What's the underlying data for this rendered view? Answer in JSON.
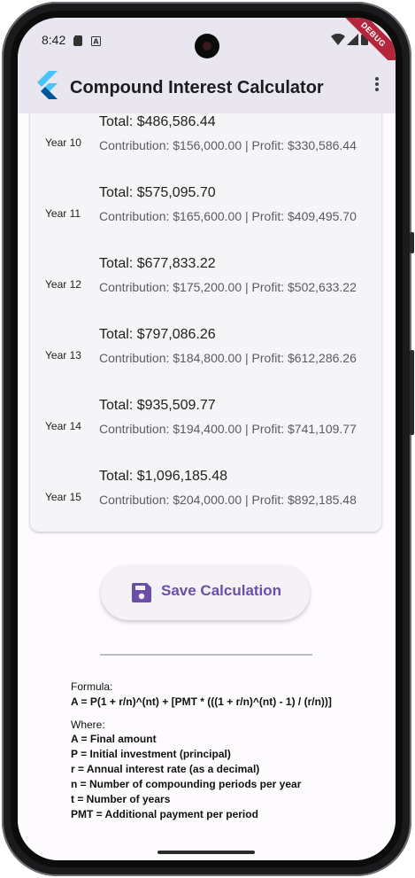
{
  "status_bar": {
    "time": "8:42",
    "debug_banner": "DEBUG"
  },
  "app_bar": {
    "title": "Compound Interest Calculator"
  },
  "results": [
    {
      "year": "Year 10",
      "total": "Total: $486,586.44",
      "detail": "Contribution: $156,000.00 | Profit: $330,586.44"
    },
    {
      "year": "Year 11",
      "total": "Total: $575,095.70",
      "detail": "Contribution: $165,600.00 | Profit: $409,495.70"
    },
    {
      "year": "Year 12",
      "total": "Total: $677,833.22",
      "detail": "Contribution: $175,200.00 | Profit: $502,633.22"
    },
    {
      "year": "Year 13",
      "total": "Total: $797,086.26",
      "detail": "Contribution: $184,800.00 | Profit: $612,286.26"
    },
    {
      "year": "Year 14",
      "total": "Total: $935,509.77",
      "detail": "Contribution: $194,400.00 | Profit: $741,109.77"
    },
    {
      "year": "Year 15",
      "total": "Total: $1,096,185.48",
      "detail": "Contribution: $204,000.00 | Profit: $892,185.48"
    }
  ],
  "save_button": {
    "label": "Save Calculation"
  },
  "formula": {
    "label": "Formula:",
    "text": "A = P(1 + r/n)^(nt) + [PMT * (((1 + r/n)^(nt) - 1) / (r/n))]",
    "where_label": "Where:",
    "definitions": [
      "A = Final amount",
      "P = Initial investment (principal)",
      "r = Annual interest rate (as a decimal)",
      "n = Number of compounding periods per year",
      "t = Number of years",
      "PMT = Additional payment per period"
    ]
  },
  "colors": {
    "app_bar_bg": "#e9e6ef",
    "accent": "#6a4fa8",
    "debug_banner": "#b3263c",
    "card_bg": "#f5f4f7"
  },
  "icons": [
    "sim-card-icon",
    "keyboard-icon",
    "wifi-icon",
    "signal-icon",
    "battery-icon",
    "flutter-logo-icon",
    "more-vert-icon",
    "save-icon"
  ]
}
